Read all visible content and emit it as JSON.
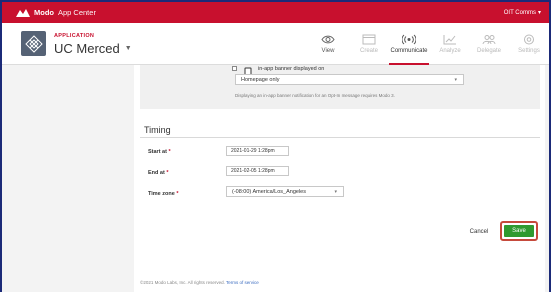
{
  "topbar": {
    "brand_bold": "Modo",
    "brand_rest": "App Center",
    "user": "OIT Comms",
    "bg_color": "#c8102e"
  },
  "header": {
    "app_label": "APPLICATION",
    "app_name": "UC Merced"
  },
  "nav": [
    {
      "label": "View",
      "icon": "eye-icon",
      "state": "normal"
    },
    {
      "label": "Create",
      "icon": "window-icon",
      "state": "disabled"
    },
    {
      "label": "Communicate",
      "icon": "broadcast-icon",
      "state": "active"
    },
    {
      "label": "Analyze",
      "icon": "chart-icon",
      "state": "disabled"
    },
    {
      "label": "Delegate",
      "icon": "users-icon",
      "state": "disabled"
    },
    {
      "label": "Settings",
      "icon": "gear-icon",
      "state": "disabled"
    }
  ],
  "banner": {
    "checkbox_label": "in-app banner displayed on",
    "select_value": "Homepage only",
    "hint": "Displaying an in-app banner notification for an Opt-In message requires Modo 3."
  },
  "timing": {
    "title": "Timing",
    "start_label": "Start at",
    "start_value": "2021-01-29 1:28pm",
    "end_label": "End at",
    "end_value": "2021-02-05 1:28pm",
    "tz_label": "Time zone",
    "tz_value": "(-08:00) America/Los_Angeles",
    "required_mark": "*"
  },
  "actions": {
    "cancel": "Cancel",
    "save": "Save",
    "save_color": "#2f9a2f"
  },
  "footer": {
    "copyright": "©2021 Modo Labs, Inc. All rights reserved.",
    "terms": "Terms of service"
  }
}
